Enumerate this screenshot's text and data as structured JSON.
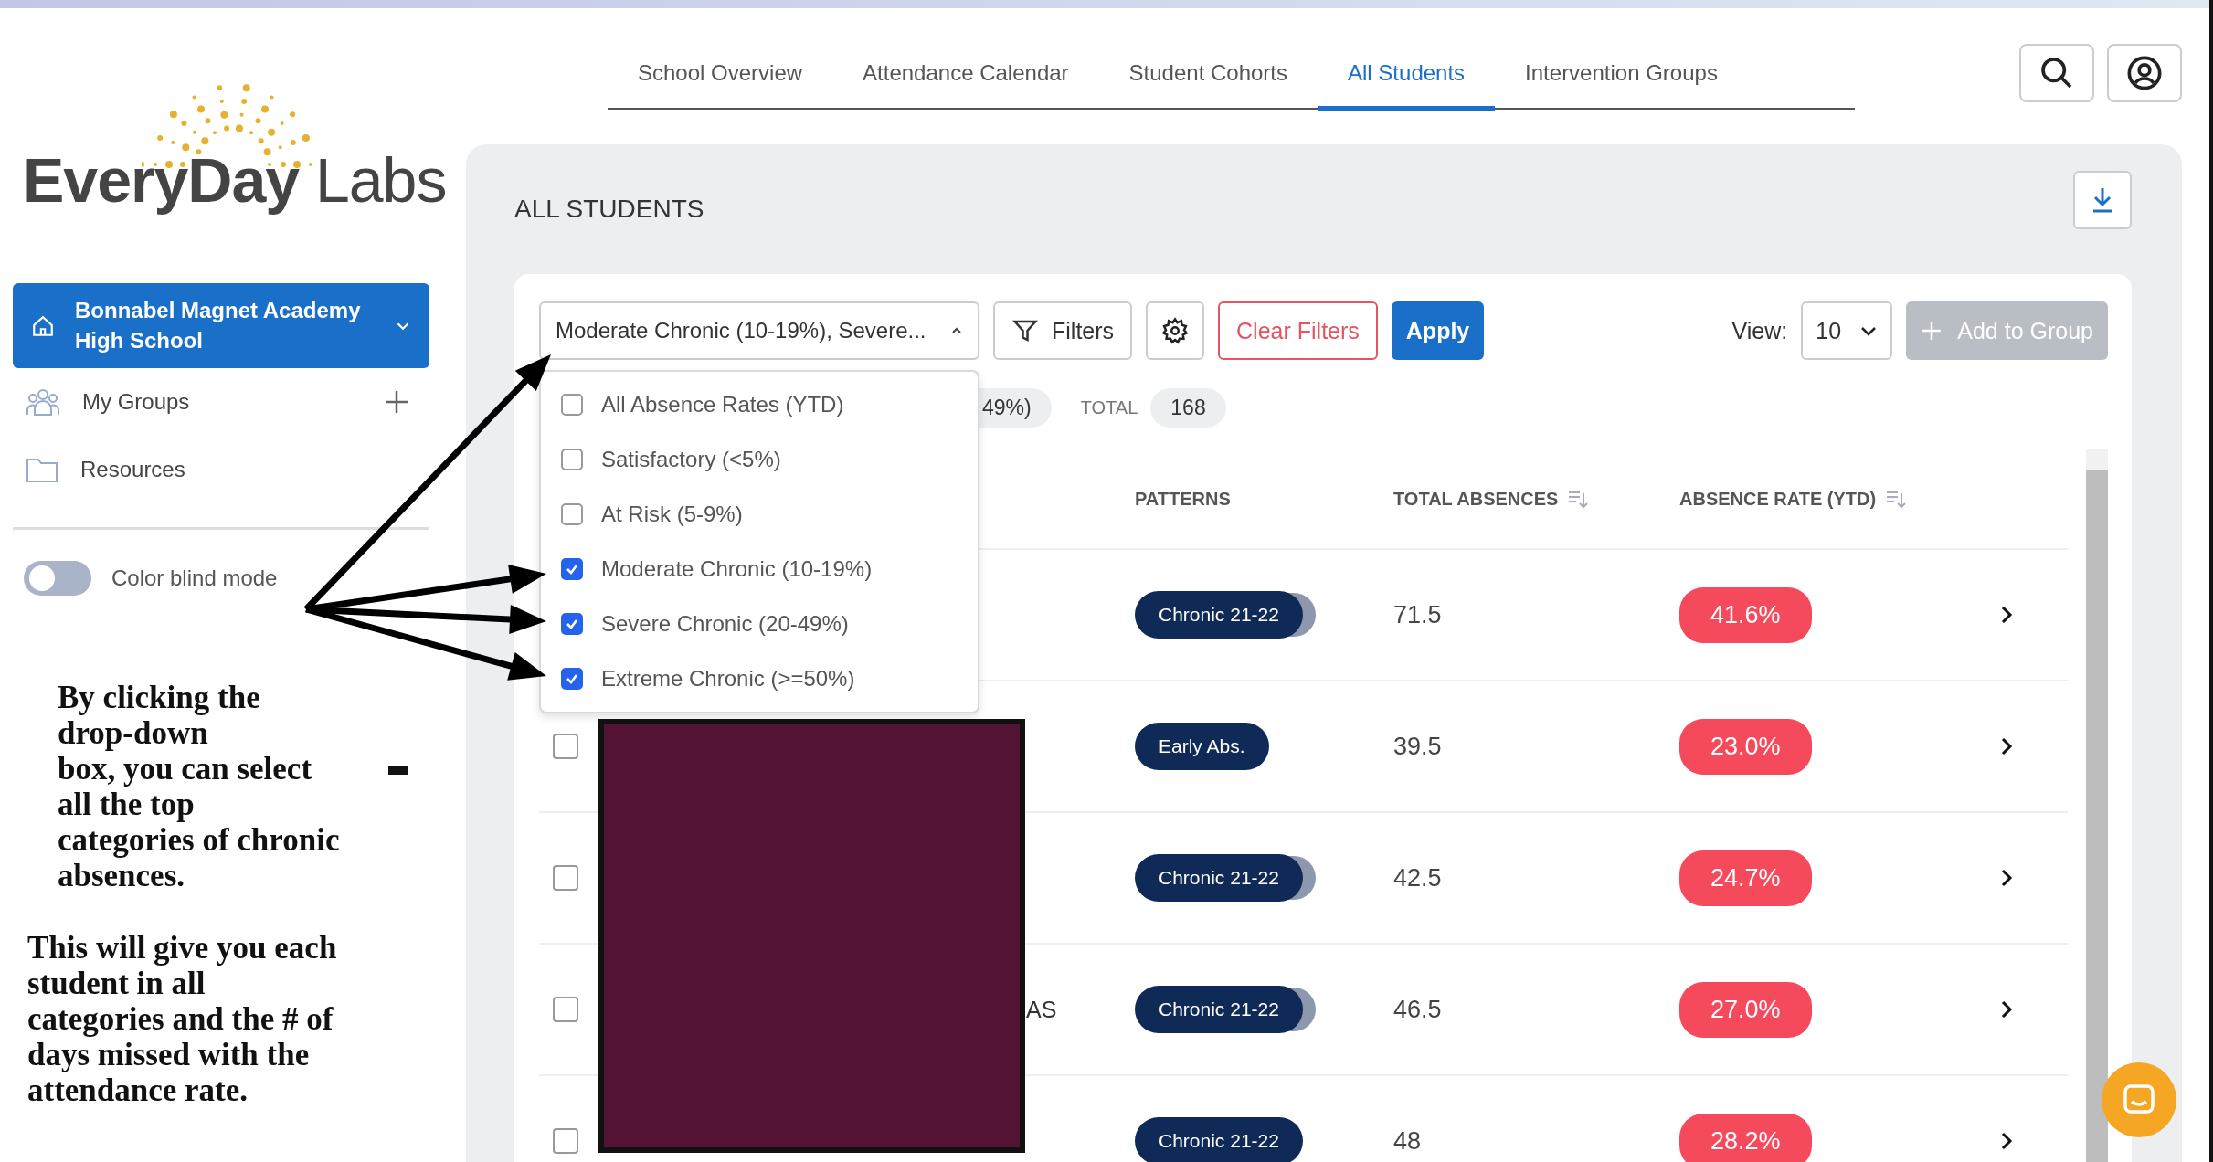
{
  "logo": {
    "text": "**EveryDay** Labs"
  },
  "nav": {
    "tabs": [
      {
        "label": "School Overview",
        "selected": false
      },
      {
        "label": "Attendance Calendar",
        "selected": false
      },
      {
        "label": "Student Cohorts",
        "selected": false
      },
      {
        "label": "All Students",
        "selected": true
      },
      {
        "label": "Intervention Groups",
        "selected": false
      }
    ]
  },
  "sidebar": {
    "school": "Bonnabel Magnet Academy High School",
    "items": [
      {
        "label": "My Groups",
        "kind": "groups"
      },
      {
        "label": "Resources",
        "kind": "folder"
      }
    ],
    "toggle": {
      "label": "Color blind mode",
      "on": false
    }
  },
  "annotation": {
    "paragraphs": [
      "By clicking the\ndrop-down\nbox, you can select\nall the top\ncategories of chronic\nabsences.",
      "This will give you each\nstudent in all\ncategories and the # of\ndays missed with the\nattendance rate."
    ]
  },
  "panel": {
    "title": "ALL STUDENTS"
  },
  "toolbar": {
    "rate_select": "Moderate Chronic (10-19%), Severe...",
    "expanded": true,
    "filters": "Filters",
    "clear": "Clear Filters",
    "apply": "Apply",
    "view_label": "View:",
    "view_value": "10",
    "add": {
      "label": "Add to Group",
      "disabled": true
    }
  },
  "menu": [
    {
      "label": "All Absence Rates (YTD)",
      "checked": false
    },
    {
      "label": "Satisfactory (<5%)",
      "checked": false
    },
    {
      "label": "At Risk (5-9%)",
      "checked": false
    },
    {
      "label": "Moderate Chronic (10-19%)",
      "checked": true
    },
    {
      "label": "Severe Chronic (20-49%)",
      "checked": true
    },
    {
      "label": "Extreme Chronic (>=50%)",
      "checked": true
    }
  ],
  "summary": {
    "chip": "49%)",
    "total_label": "TOTAL",
    "total": "168"
  },
  "table": {
    "columns": [
      {
        "label": "PATTERNS",
        "sortable": false
      },
      {
        "label": "TOTAL ABSENCES",
        "sortable": true
      },
      {
        "label": "ABSENCE RATE (YTD)",
        "sortable": true
      }
    ],
    "rows": [
      {
        "pattern": "Chronic 21-22",
        "stacked": true,
        "absences": "71.5",
        "rate": "41.6%"
      },
      {
        "checked": false,
        "pattern": "Early Abs.",
        "stacked": false,
        "absences": "39.5",
        "rate": "23.0%"
      },
      {
        "checked": false,
        "pattern": "Chronic 21-22",
        "stacked": true,
        "absences": "42.5",
        "rate": "24.7%"
      },
      {
        "checked": false,
        "name_visible": "AS",
        "pattern": "Chronic 21-22",
        "stacked": true,
        "absences": "46.5",
        "rate": "27.0%"
      },
      {
        "checked": false,
        "pattern": "Chronic 21-22",
        "stacked": false,
        "absences": "48",
        "rate": "28.2%"
      }
    ]
  }
}
